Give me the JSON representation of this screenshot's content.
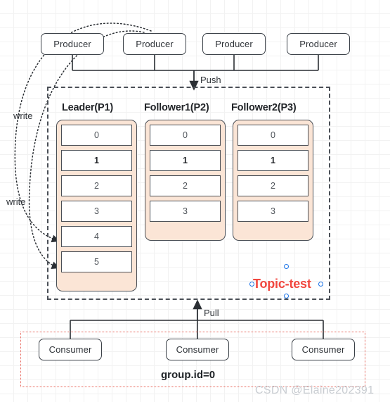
{
  "diagram": {
    "title": "Kafka topic replication and consumer group diagram",
    "colors": {
      "partition_fill": "#fbe5d6",
      "stroke": "#4a4f56",
      "topic_accent": "#f1473f",
      "group_border": "#e8655b",
      "selection_handle": "#1a73e8"
    }
  },
  "producers": [
    {
      "label": "Producer"
    },
    {
      "label": "Producer"
    },
    {
      "label": "Producer"
    },
    {
      "label": "Producer"
    }
  ],
  "edges": {
    "push_label": "Push",
    "pull_label": "Pull",
    "write_label_top": "write",
    "write_label_bottom": "write"
  },
  "broker": {
    "topic_label": "Topic-test",
    "partitions": [
      {
        "title": "Leader(P1)",
        "cells": [
          {
            "value": "0",
            "bold": false
          },
          {
            "value": "1",
            "bold": true
          },
          {
            "value": "2",
            "bold": false
          },
          {
            "value": "3",
            "bold": false
          },
          {
            "value": "4",
            "bold": false
          },
          {
            "value": "5",
            "bold": false
          }
        ]
      },
      {
        "title": "Follower1(P2)",
        "cells": [
          {
            "value": "0",
            "bold": false
          },
          {
            "value": "1",
            "bold": true
          },
          {
            "value": "2",
            "bold": false
          },
          {
            "value": "3",
            "bold": false
          }
        ]
      },
      {
        "title": "Follower2(P3)",
        "cells": [
          {
            "value": "0",
            "bold": false
          },
          {
            "value": "1",
            "bold": true
          },
          {
            "value": "2",
            "bold": false
          },
          {
            "value": "3",
            "bold": false
          }
        ]
      }
    ]
  },
  "consumer_group": {
    "group_id": "group.id=0",
    "consumers": [
      {
        "label": "Consumer"
      },
      {
        "label": "Consumer"
      },
      {
        "label": "Consumer"
      }
    ]
  },
  "watermark": {
    "text": "CSDN @Elaine202391"
  }
}
